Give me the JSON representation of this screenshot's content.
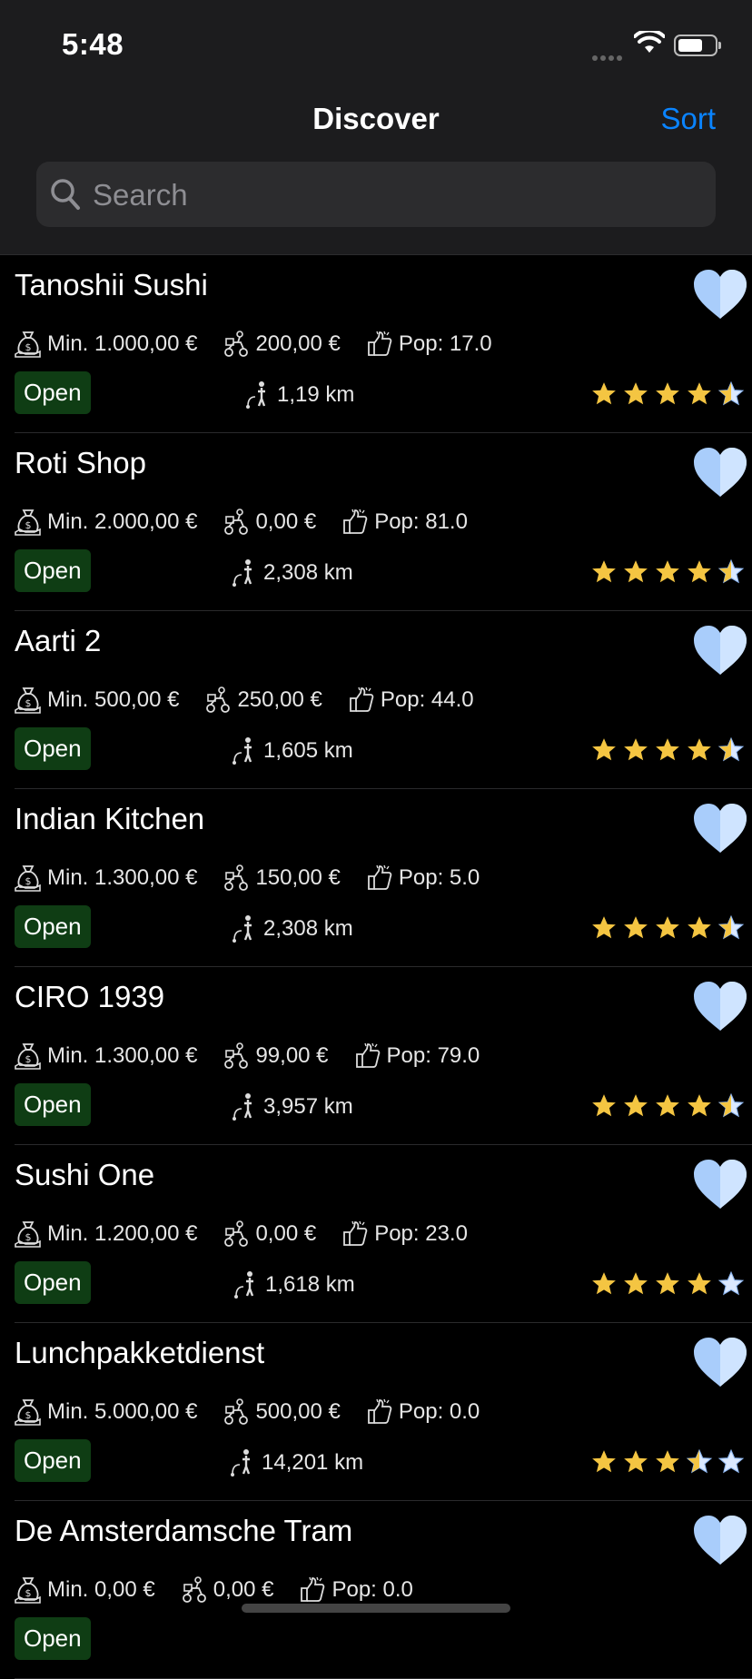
{
  "status": {
    "time": "5:48"
  },
  "nav": {
    "title": "Discover",
    "sort_label": "Sort"
  },
  "search": {
    "placeholder": "Search",
    "value": ""
  },
  "colors": {
    "accent": "#0a84ff",
    "open_badge": "#0f3d14",
    "star": "#f4c542",
    "heart": "#bcdcff"
  },
  "restaurants": [
    {
      "name": "Tanoshii Sushi",
      "min_order": "Min. 1.000,00 €",
      "delivery": "200,00 €",
      "popularity": "Pop: 17.0",
      "status": "Open",
      "distance": "1,19 km",
      "rating": 4.5
    },
    {
      "name": "Roti Shop",
      "min_order": "Min. 2.000,00 €",
      "delivery": "0,00 €",
      "popularity": "Pop: 81.0",
      "status": "Open",
      "distance": "2,308 km",
      "rating": 4.5
    },
    {
      "name": "Aarti 2",
      "min_order": "Min. 500,00 €",
      "delivery": "250,00 €",
      "popularity": "Pop: 44.0",
      "status": "Open",
      "distance": "1,605 km",
      "rating": 4.5
    },
    {
      "name": "Indian Kitchen",
      "min_order": "Min. 1.300,00 €",
      "delivery": "150,00 €",
      "popularity": "Pop: 5.0",
      "status": "Open",
      "distance": "2,308 km",
      "rating": 4.5
    },
    {
      "name": "CIRO 1939",
      "min_order": "Min. 1.300,00 €",
      "delivery": "99,00 €",
      "popularity": "Pop: 79.0",
      "status": "Open",
      "distance": "3,957 km",
      "rating": 4.5
    },
    {
      "name": "Sushi One",
      "min_order": "Min. 1.200,00 €",
      "delivery": "0,00 €",
      "popularity": "Pop: 23.0",
      "status": "Open",
      "distance": "1,618 km",
      "rating": 4
    },
    {
      "name": "Lunchpakketdienst",
      "min_order": "Min. 5.000,00 €",
      "delivery": "500,00 €",
      "popularity": "Pop: 0.0",
      "status": "Open",
      "distance": "14,201 km",
      "rating": 3.5
    },
    {
      "name": "De Amsterdamsche Tram",
      "min_order": "Min. 0,00 €",
      "delivery": "0,00 €",
      "popularity": "Pop: 0.0",
      "status": "Open",
      "distance": "",
      "rating": 0
    }
  ]
}
